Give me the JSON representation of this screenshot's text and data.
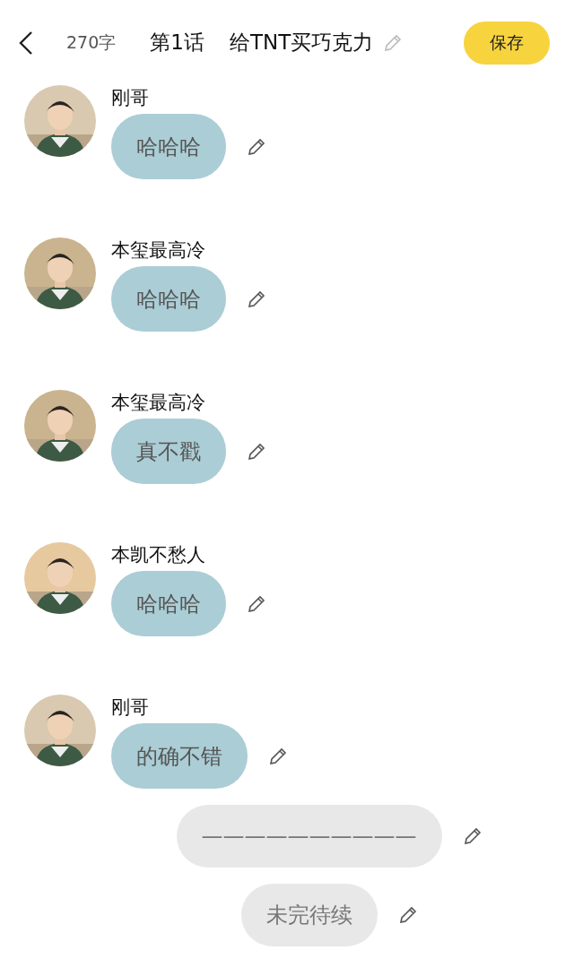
{
  "header": {
    "word_count": "270字",
    "episode": "第1话",
    "title": "给TNT买巧克力",
    "save": "保存"
  },
  "messages": [
    {
      "kind": "character",
      "name": "刚哥",
      "text": "哈哈哈",
      "color": "#d9c9b0"
    },
    {
      "kind": "character",
      "name": "本玺最高冷",
      "text": "哈哈哈",
      "color": "#c9b48f"
    },
    {
      "kind": "character",
      "name": "本玺最高冷",
      "text": "真不戳",
      "color": "#c9b48f"
    },
    {
      "kind": "character",
      "name": "本凯不愁人",
      "text": "哈哈哈",
      "color": "#e7c9a0"
    },
    {
      "kind": "character",
      "name": "刚哥",
      "text": "的确不错",
      "color": "#d9c9b0"
    },
    {
      "kind": "narration",
      "text": "——————————"
    },
    {
      "kind": "narration",
      "text": "未完待续"
    }
  ]
}
